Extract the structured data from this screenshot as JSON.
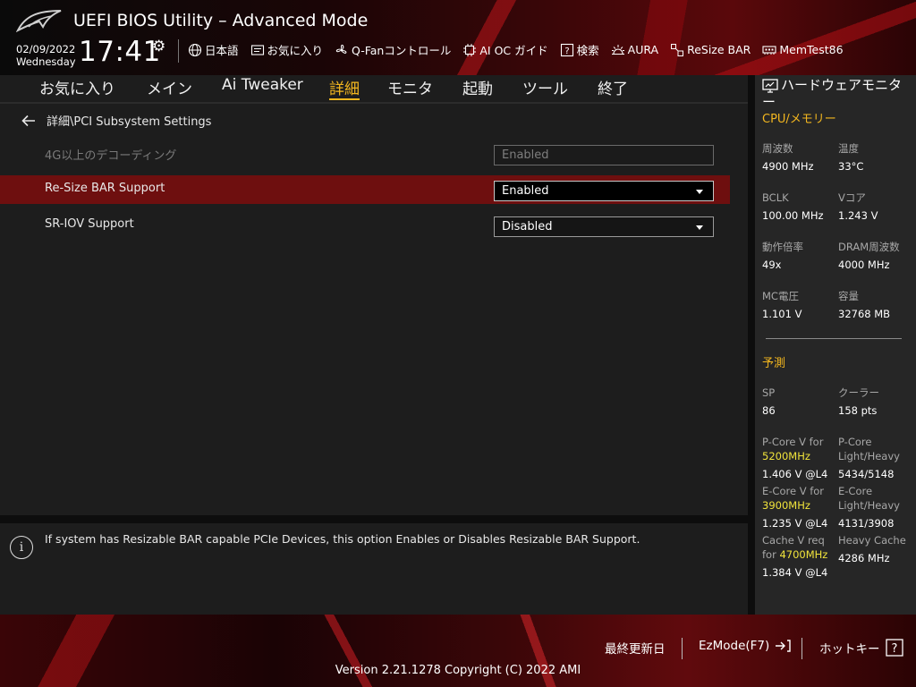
{
  "header": {
    "title": "UEFI BIOS Utility – Advanced Mode",
    "date": "02/09/2022",
    "weekday": "Wednesday",
    "time": "17:41",
    "toolbar": [
      {
        "icon": "globe-icon",
        "label": "日本語"
      },
      {
        "icon": "favorites-icon",
        "label": "お気に入り"
      },
      {
        "icon": "fan-icon",
        "label": "Q-Fanコントロール"
      },
      {
        "icon": "ai-chip-icon",
        "label": "AI OC ガイド"
      },
      {
        "icon": "help-search-icon",
        "label": "検索"
      },
      {
        "icon": "aura-icon",
        "label": "AURA"
      },
      {
        "icon": "resize-bar-icon",
        "label": "ReSize BAR"
      },
      {
        "icon": "memtest-icon",
        "label": "MemTest86"
      }
    ]
  },
  "tabs": [
    "お気に入り",
    "メイン",
    "Ai Tweaker",
    "詳細",
    "モニタ",
    "起動",
    "ツール",
    "終了"
  ],
  "active_tab": "詳細",
  "breadcrumb": "詳細\\PCI Subsystem Settings",
  "settings": [
    {
      "label": "4G以上のデコーディング",
      "value": "Enabled"
    },
    {
      "label": "Re-Size BAR Support",
      "value": "Enabled"
    },
    {
      "label": "SR-IOV Support",
      "value": "Disabled"
    }
  ],
  "help_text": "If system has Resizable BAR capable PCIe Devices, this option Enables or Disables Resizable BAR Support.",
  "hwmon": {
    "title": "ハードウェアモニター",
    "cpu_section": "CPU/メモリー",
    "freq_label": "周波数",
    "freq_value": "4900 MHz",
    "temp_label": "温度",
    "temp_value": "33°C",
    "bclk_label": "BCLK",
    "bclk_value": "100.00 MHz",
    "vcore_label": "Vコア",
    "vcore_value": "1.243 V",
    "ratio_label": "動作倍率",
    "ratio_value": "49x",
    "dram_label": "DRAM周波数",
    "dram_value": "4000 MHz",
    "mc_label": "MC電圧",
    "mc_value": "1.101 V",
    "cap_label": "容量",
    "cap_value": "32768 MB",
    "pred_section": "予測",
    "sp_label": "SP",
    "sp_value": "86",
    "cooler_label": "クーラー",
    "cooler_value": "158 pts",
    "pcore_v_label": "P-Core V for",
    "pcore_v_freq": "5200MHz",
    "pcore_v_value": "1.406 V @L4",
    "pcore_lh_label1": "P-Core",
    "pcore_lh_label2": "Light/Heavy",
    "pcore_lh_value": "5434/5148",
    "ecore_v_label": "E-Core V for",
    "ecore_v_freq": "3900MHz",
    "ecore_v_value": "1.235 V @L4",
    "ecore_lh_label1": "E-Core",
    "ecore_lh_label2": "Light/Heavy",
    "ecore_lh_value": "4131/3908",
    "cache_label1": "Cache V req",
    "cache_label2": "for",
    "cache_freq": "4700MHz",
    "cache_value": "1.384 V @L4",
    "heavy_cache_label": "Heavy Cache",
    "heavy_cache_value": "4286 MHz"
  },
  "footer": {
    "last_modified": "最終更新日",
    "ezmode": "EzMode(F7)",
    "hotkeys": "ホットキー",
    "version": "Version 2.21.1278 Copyright (C) 2022 AMI"
  }
}
